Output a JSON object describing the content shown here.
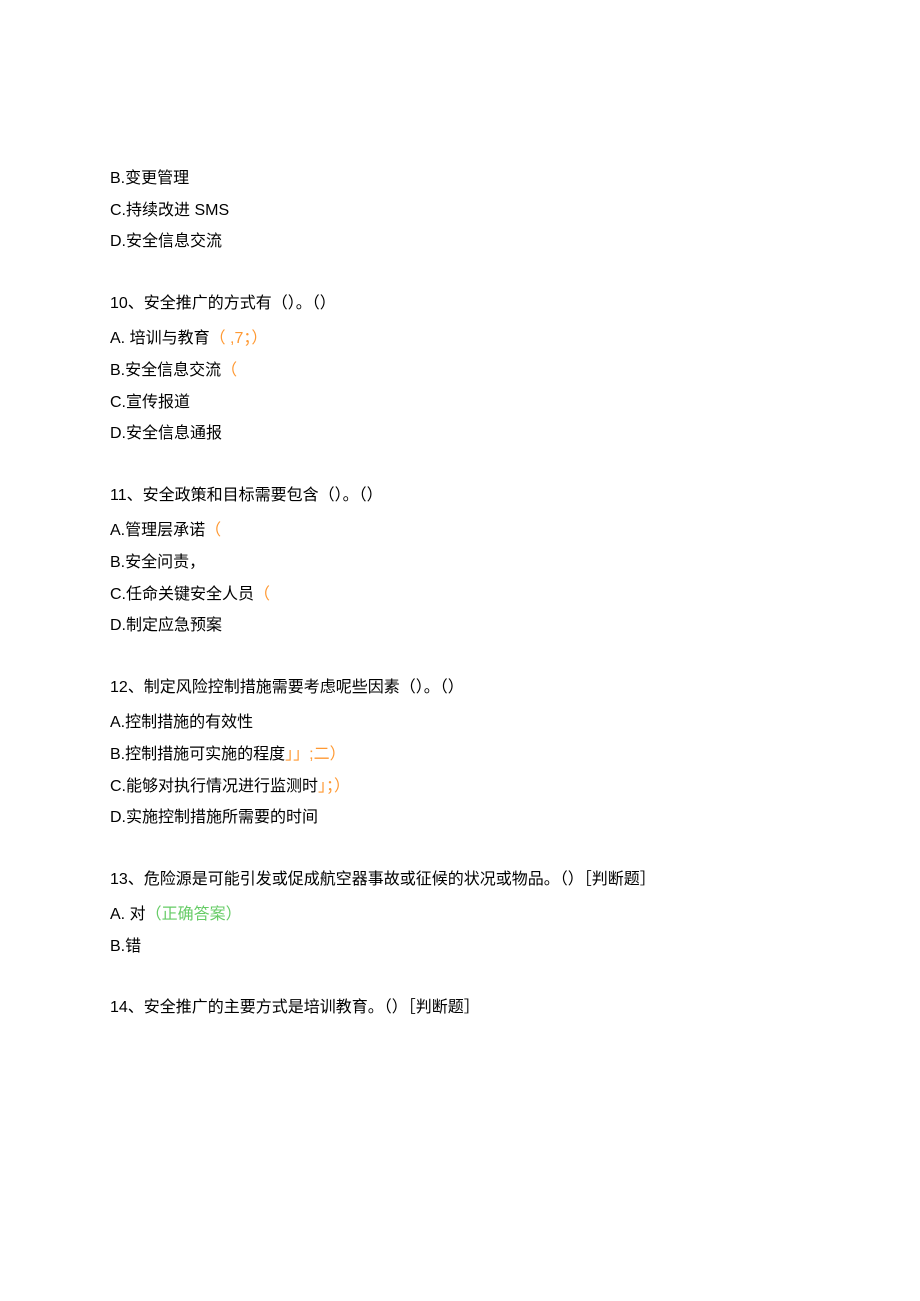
{
  "items": [
    {
      "type": "option",
      "prefix": "B.",
      "text": "变更管理"
    },
    {
      "type": "option",
      "prefix": "C.",
      "text": "持续改进 SMS"
    },
    {
      "type": "option",
      "prefix": "D.",
      "text": "安全信息交流"
    },
    {
      "type": "question",
      "text": "10、安全推广的方式有（）。（）"
    },
    {
      "type": "option",
      "prefix": "A. ",
      "text": "培训与教育",
      "suffix_orange": "（  ,7；）"
    },
    {
      "type": "option",
      "prefix": "B.",
      "text": "安全信息交流",
      "suffix_orange": "（"
    },
    {
      "type": "option",
      "prefix": "C.",
      "text": "宣传报道"
    },
    {
      "type": "option",
      "prefix": "D.",
      "text": "安全信息通报"
    },
    {
      "type": "question",
      "text": "11、安全政策和目标需要包含（）。（）"
    },
    {
      "type": "option",
      "prefix": "A.",
      "text": "管理层承诺",
      "suffix_orange": "（"
    },
    {
      "type": "option",
      "prefix": "B.",
      "text": "安全问责，"
    },
    {
      "type": "option",
      "prefix": "C.",
      "text": "任命关键安全人员",
      "suffix_orange": "（"
    },
    {
      "type": "option",
      "prefix": "D.",
      "text": "制定应急预案"
    },
    {
      "type": "question",
      "text": "12、制定风险控制措施需要考虑呢些因素（）。（）"
    },
    {
      "type": "option",
      "prefix": "A.",
      "text": "控制措施的有效性"
    },
    {
      "type": "option",
      "prefix": "B.",
      "text": "控制措施可实施的程度",
      "suffix_orange": "」」;二）"
    },
    {
      "type": "option",
      "prefix": "C.",
      "text": "能够对执行情况进行监测时",
      "suffix_orange": "」；）"
    },
    {
      "type": "option",
      "prefix": "D.",
      "text": "实施控制措施所需要的时间"
    },
    {
      "type": "question",
      "text": "13、危险源是可能引发或促成航空器事故或征候的状况或物品。（）［判断题］"
    },
    {
      "type": "option",
      "prefix": "A. ",
      "text": "对",
      "suffix_correct": "（正确答案）"
    },
    {
      "type": "option",
      "prefix": "B.",
      "text": "错"
    },
    {
      "type": "question",
      "text": "14、安全推广的主要方式是培训教育。（）［判断题］"
    }
  ]
}
